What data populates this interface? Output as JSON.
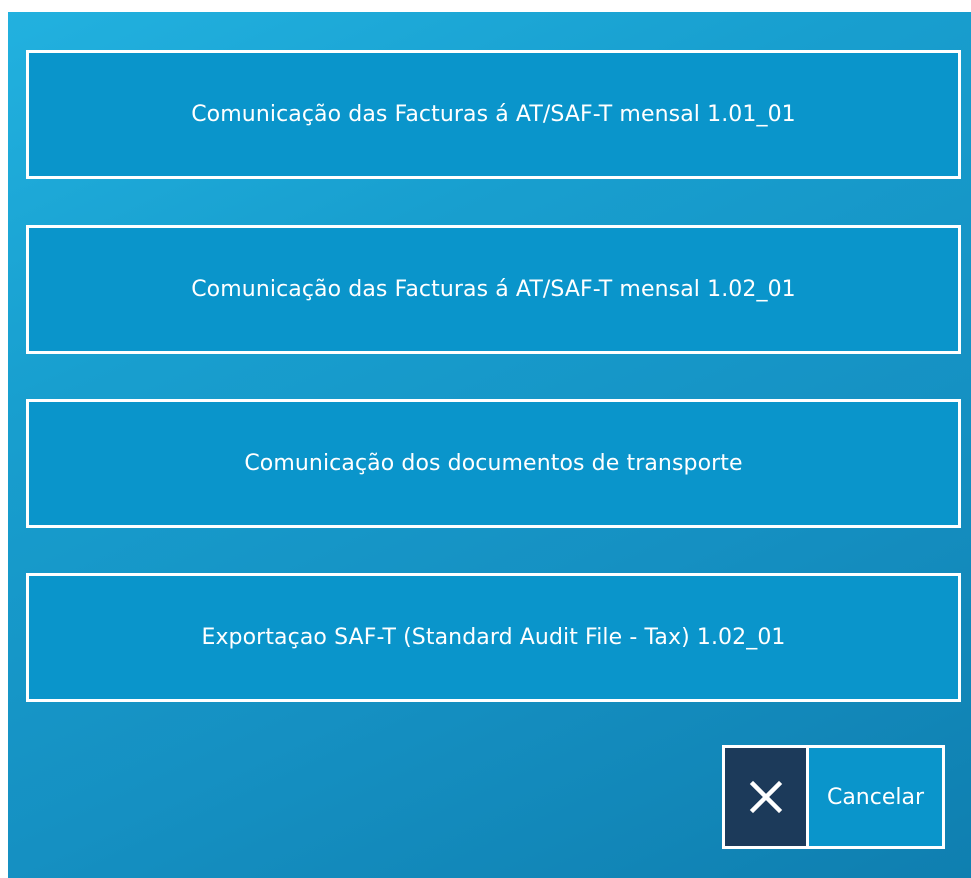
{
  "options": [
    {
      "label": "Comunicação das Facturas á AT/SAF-T mensal 1.01_01"
    },
    {
      "label": "Comunicação das Facturas á AT/SAF-T mensal 1.02_01"
    },
    {
      "label": "Comunicação dos documentos de transporte"
    },
    {
      "label": "Exportaçao SAF-T (Standard Audit File - Tax) 1.02_01"
    }
  ],
  "cancel": {
    "label": "Cancelar",
    "icon": "close-icon"
  },
  "colors": {
    "background_gradient_start": "#22b1df",
    "background_gradient_end": "#0f7fb0",
    "button_fill": "#0a95cb",
    "button_border": "#ffffff",
    "cancel_icon_bg": "#1c3a5a",
    "text": "#ffffff"
  }
}
